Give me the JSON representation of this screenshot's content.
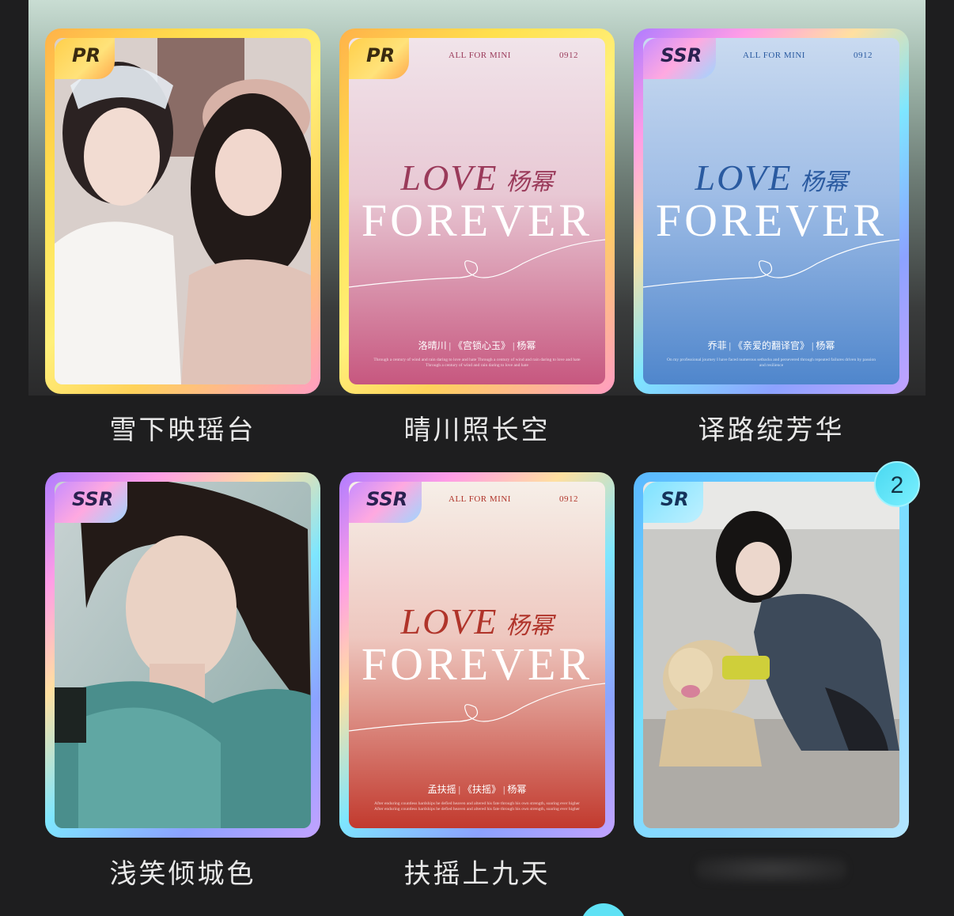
{
  "cards": [
    {
      "rarity": "PR",
      "title": "雪下映瑶台",
      "kind": "photo",
      "photo_desc_icon": "two-women-costume-photo"
    },
    {
      "rarity": "PR",
      "title": "晴川照长空",
      "kind": "poster",
      "poster": {
        "header_left": "ALL FOR MINI",
        "header_right": "0912",
        "line1": "LOVE",
        "line2": "FOREVER",
        "signature": "杨幂",
        "subtitle": "洛晴川 | 《宫锁心玉》 | 杨幂",
        "tiny": "Through a century of wind and rain daring to love and hate Through a century of wind and rain daring to love and hate Through a century of wind and rain daring to love and hate",
        "bg_top": "#f1e4ea",
        "bg_bottom": "#c7577f",
        "ink": "#9a3a5a"
      }
    },
    {
      "rarity": "SSR",
      "title": "译路绽芳华",
      "kind": "poster",
      "poster": {
        "header_left": "ALL FOR MINI",
        "header_right": "0912",
        "line1": "LOVE",
        "line2": "FOREVER",
        "signature": "杨幂",
        "subtitle": "乔菲 | 《亲爱的翻译官》 | 杨幂",
        "tiny": "On my professional journey I have faced numerous setbacks and persevered through repeated failures driven by passion and resilience",
        "bg_top": "#c9daf0",
        "bg_bottom": "#4f86cc",
        "ink": "#2a5aa0"
      }
    },
    {
      "rarity": "SSR",
      "title": "浅笑倾城色",
      "kind": "photo",
      "photo_desc_icon": "woman-teal-costume-photo"
    },
    {
      "rarity": "SSR",
      "title": "扶摇上九天",
      "kind": "poster",
      "poster": {
        "header_left": "ALL FOR MINI",
        "header_right": "0912",
        "line1": "LOVE",
        "line2": "FOREVER",
        "signature": "杨幂",
        "subtitle": "孟扶摇 | 《扶摇》 | 杨幂",
        "tiny": "After enduring countless hardships he defied heaven and altered his fate through his own strength, soaring ever higher After enduring countless hardships he defied heaven and altered his fate through his own strength, soaring ever higher",
        "bg_top": "#f6efe8",
        "bg_bottom": "#c23a2e",
        "ink": "#b0342a"
      }
    },
    {
      "rarity": "SR",
      "title": "",
      "kind": "photo",
      "photo_desc_icon": "woman-with-dog-photo",
      "badge": "2"
    }
  ]
}
